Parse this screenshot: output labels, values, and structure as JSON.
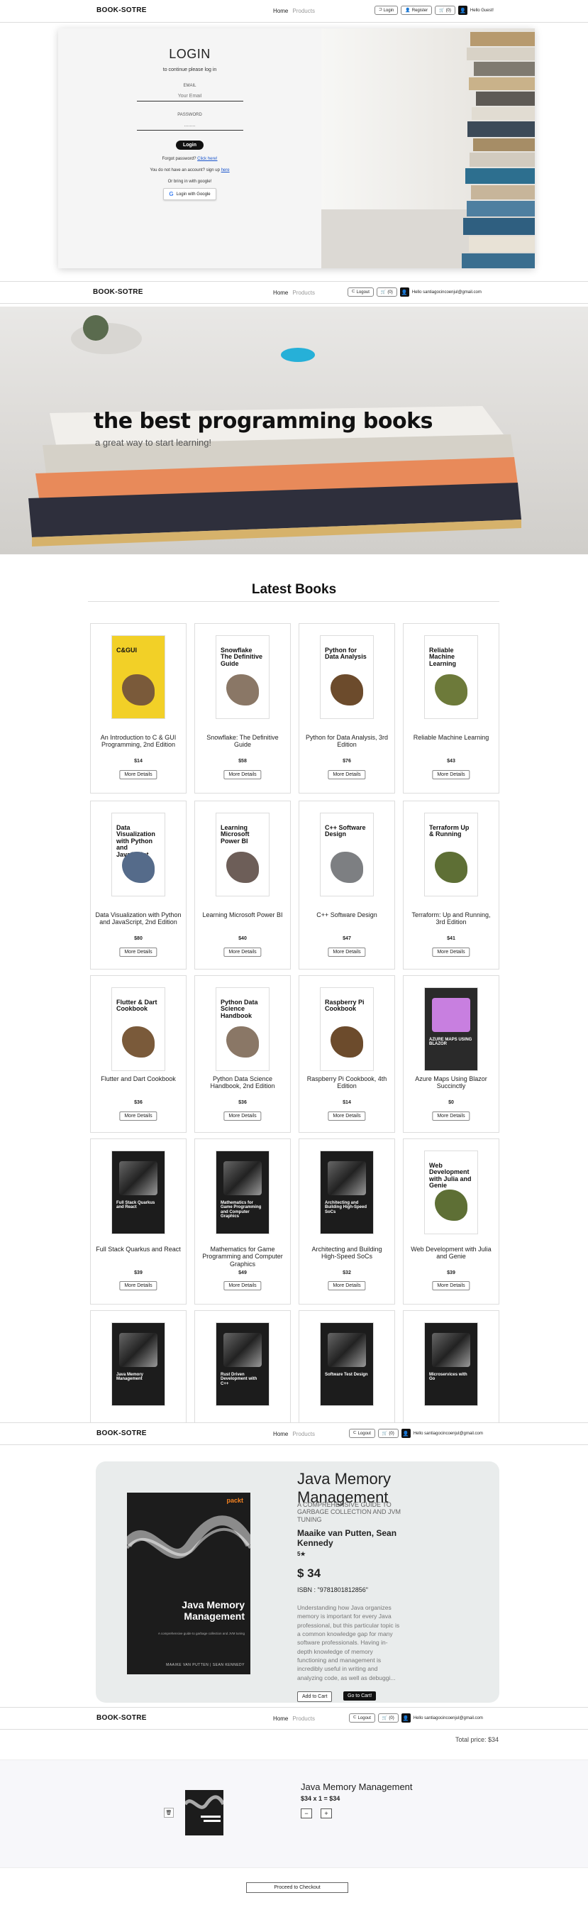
{
  "brand": "BOOK-SOTRE",
  "nav": {
    "home": "Home",
    "products": "Products"
  },
  "nav_guest": {
    "login": "Login",
    "register": "Register",
    "cart": "(0)",
    "greeting": "Hello Guest!"
  },
  "nav_user": {
    "logout": "Logout",
    "cart": "(0)",
    "greeting": "Hello santiagocincoenjul@gmail.com"
  },
  "login": {
    "title": "LOGIN",
    "subtitle": "to continue please log in",
    "email_label": "EMAIL",
    "email_placeholder": "Your Email",
    "password_label": "PASSWORD",
    "password_value": "........",
    "login_button": "Login",
    "forgot_text": "Forgot password?",
    "forgot_link": "Click here!",
    "signup_text": "You do not have an account? sign up",
    "signup_link": "here",
    "google_text": "Or bring in with google!",
    "google_button": "Login with Google"
  },
  "hero": {
    "title": "the best programming books",
    "subtitle": "a great way to start learning!"
  },
  "latest_heading": "Latest Books",
  "more_details": "More Details",
  "books": [
    {
      "title": "An Introduction to C & GUI Programming, 2nd Edition",
      "price": "$14",
      "cover_text": "C&GUI",
      "cover_bg": "#f2d027"
    },
    {
      "title": "Snowflake: The Definitive Guide",
      "price": "$58",
      "cover_text": "Snowflake The Definitive Guide",
      "cover_bg": "#ffffff"
    },
    {
      "title": "Python for Data Analysis, 3rd Edition",
      "price": "$76",
      "cover_text": "Python for Data Analysis",
      "cover_bg": "#ffffff"
    },
    {
      "title": "Reliable Machine Learning",
      "price": "$43",
      "cover_text": "Reliable Machine Learning",
      "cover_bg": "#ffffff"
    },
    {
      "title": "Data Visualization with Python and JavaScript, 2nd Edition",
      "price": "$80",
      "cover_text": "Data Visualization with Python and JavaScript",
      "cover_bg": "#ffffff"
    },
    {
      "title": "Learning Microsoft Power BI",
      "price": "$40",
      "cover_text": "Learning Microsoft Power BI",
      "cover_bg": "#ffffff"
    },
    {
      "title": "C++ Software Design",
      "price": "$47",
      "cover_text": "C++ Software Design",
      "cover_bg": "#ffffff"
    },
    {
      "title": "Terraform: Up and Running, 3rd Edition",
      "price": "$41",
      "cover_text": "Terraform Up & Running",
      "cover_bg": "#ffffff"
    },
    {
      "title": "Flutter and Dart Cookbook",
      "price": "$36",
      "cover_text": "Flutter & Dart Cookbook",
      "cover_bg": "#ffffff"
    },
    {
      "title": "Python Data Science Handbook, 2nd Edition",
      "price": "$36",
      "cover_text": "Python Data Science Handbook",
      "cover_bg": "#ffffff"
    },
    {
      "title": "Raspberry Pi Cookbook, 4th Edition",
      "price": "$14",
      "cover_text": "Raspberry Pi Cookbook",
      "cover_bg": "#ffffff"
    },
    {
      "title": "Azure Maps Using Blazor Succinctly",
      "price": "$0",
      "cover_text": "AZURE MAPS USING BLAZOR",
      "cover_bg": "#2a2a2a"
    },
    {
      "title": "Full Stack Quarkus and React",
      "price": "$39",
      "cover_text": "Full Stack Quarkus and React",
      "cover_bg": "#1c1c1c"
    },
    {
      "title": "Mathematics for Game Programming and Computer Graphics",
      "price": "$49",
      "cover_text": "Mathematics for Game Programming and Computer Graphics",
      "cover_bg": "#1c1c1c"
    },
    {
      "title": "Architecting and Building High-Speed SoCs",
      "price": "$32",
      "cover_text": "Architecting and Building High-Speed SoCs",
      "cover_bg": "#1c1c1c"
    },
    {
      "title": "Web Development with Julia and Genie",
      "price": "$39",
      "cover_text": "Web Development with Julia and Genie",
      "cover_bg": "#ffffff"
    },
    {
      "title": "",
      "price": "",
      "cover_text": "Java Memory Management",
      "cover_bg": "#1c1c1c"
    },
    {
      "title": "",
      "price": "",
      "cover_text": "Rust Driven Development with C++",
      "cover_bg": "#1c1c1c"
    },
    {
      "title": "",
      "price": "",
      "cover_text": "Software Test Design",
      "cover_bg": "#1c1c1c"
    },
    {
      "title": "",
      "price": "",
      "cover_text": "Microservices with Go",
      "cover_bg": "#1c1c1c"
    }
  ],
  "detail": {
    "title": "Java Memory Management",
    "subtitle": "A COMPREHENSIVE GUIDE TO GARBAGE COLLECTION AND JVM TUNING",
    "authors": "Maaike van Putten, Sean Kennedy",
    "rating": "5★",
    "price": "$ 34",
    "isbn": "ISBN : \"9781801812856\"",
    "description": "Understanding how Java organizes memory is important for every Java professional, but this particular topic is a common knowledge gap for many software professionals. Having in-depth knowledge of memory functioning and management is incredibly useful in writing and analyzing code, as well as debuggi...",
    "add_to_cart": "Add to Cart",
    "go_to_cart": "Go to Cart!",
    "cover_title": "Java Memory Management",
    "cover_publisher": "packt",
    "cover_authors": "MAAIKE VAN PUTTEN | SEAN KENNEDY",
    "cover_tagline": "A comprehensive guide to garbage collection and JVM tuning"
  },
  "cart": {
    "total": "Total price: $34",
    "remove": "🗑",
    "item_title": "Java Memory Management",
    "item_qty": "$34 x 1 = $34",
    "minus": "−",
    "plus": "+",
    "checkout": "Proceed to Checkout"
  }
}
